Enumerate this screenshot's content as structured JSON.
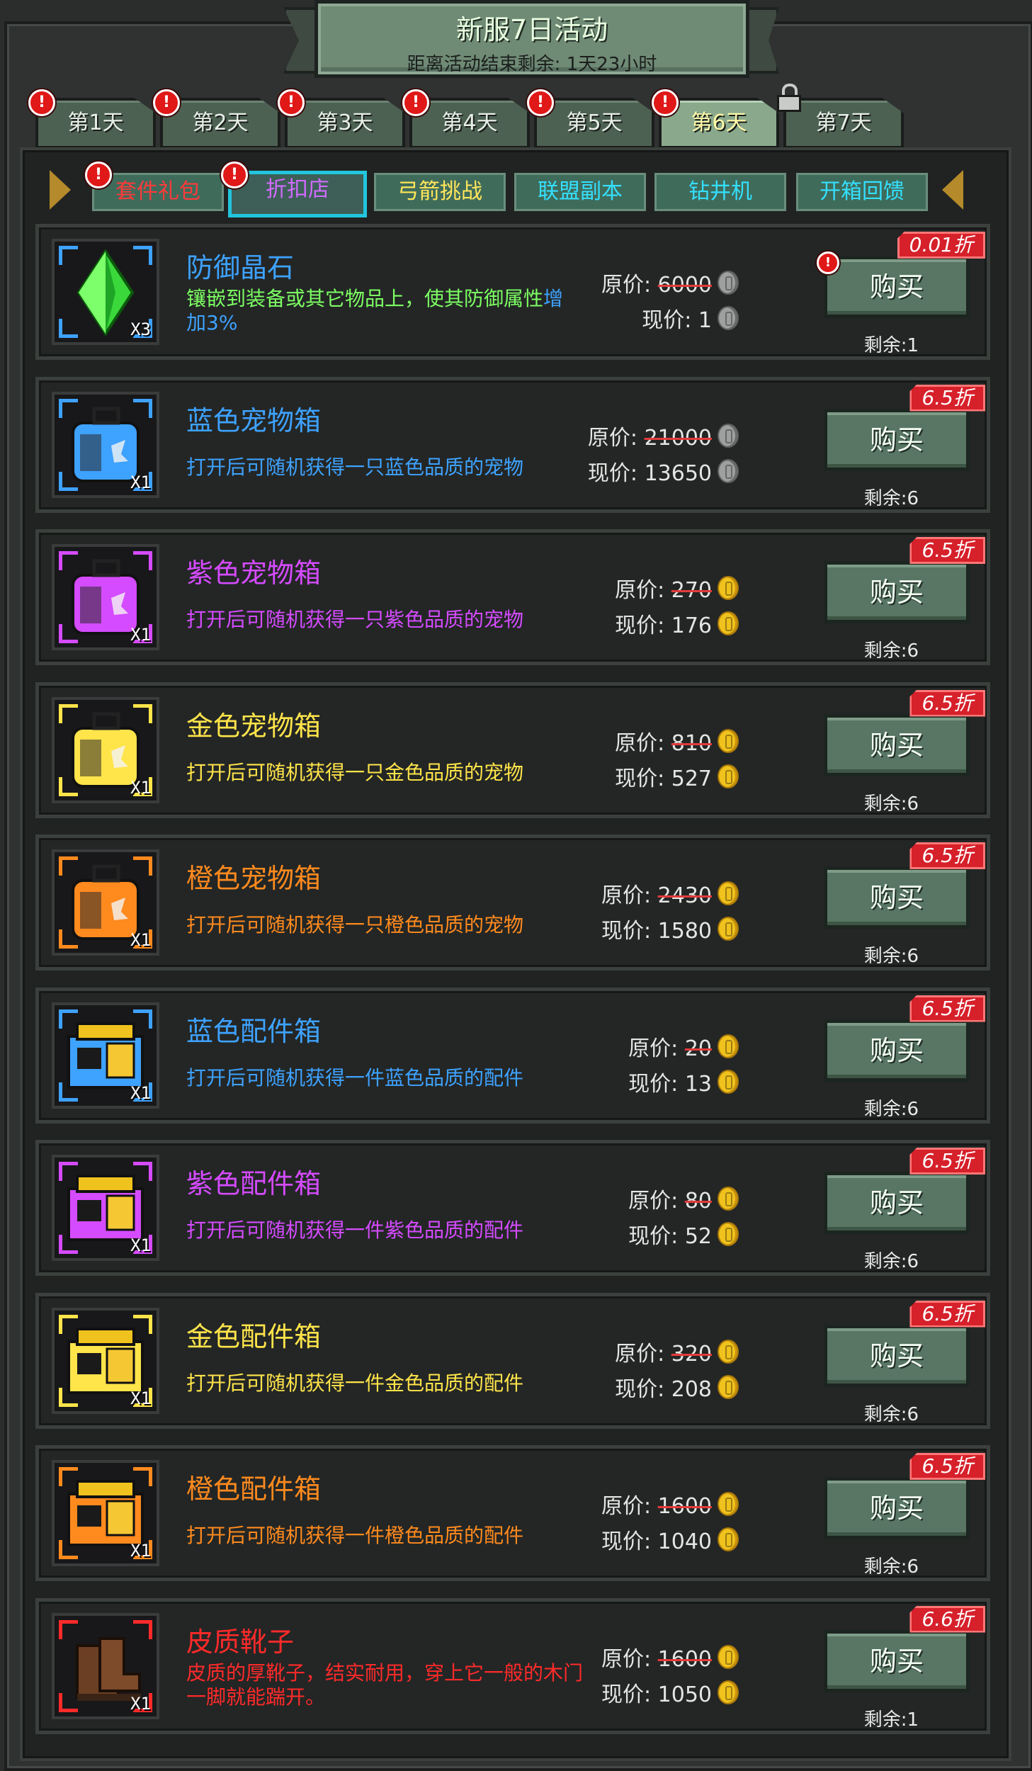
{
  "header": {
    "title": "新服7日活动",
    "subtitle": "距离活动结束剩余: 1天23小时"
  },
  "day_tabs": [
    {
      "label": "第1天",
      "alert": true,
      "active": false,
      "locked": false
    },
    {
      "label": "第2天",
      "alert": true,
      "active": false,
      "locked": false
    },
    {
      "label": "第3天",
      "alert": true,
      "active": false,
      "locked": false
    },
    {
      "label": "第4天",
      "alert": true,
      "active": false,
      "locked": false
    },
    {
      "label": "第5天",
      "alert": true,
      "active": false,
      "locked": false
    },
    {
      "label": "第6天",
      "alert": true,
      "active": true,
      "locked": false
    },
    {
      "label": "第7天",
      "alert": false,
      "active": false,
      "locked": true
    }
  ],
  "sub_tabs": [
    {
      "label": "套件礼包",
      "alert": true,
      "active": false,
      "color": "#ff3a3a"
    },
    {
      "label": "折扣店",
      "alert": true,
      "active": true,
      "color": "#d26bff"
    },
    {
      "label": "弓箭挑战",
      "alert": false,
      "active": false,
      "color": "#ffe65a"
    },
    {
      "label": "联盟副本",
      "alert": false,
      "active": false,
      "color": "#34e0ff"
    },
    {
      "label": "钻井机",
      "alert": false,
      "active": false,
      "color": "#34e0ff"
    },
    {
      "label": "开箱回馈",
      "alert": false,
      "active": false,
      "color": "#34e0ff"
    }
  ],
  "alert_mark": "!",
  "labels": {
    "original_price": "原价: ",
    "current_price": "现价: ",
    "buy": "购买",
    "remaining_prefix": "剩余:"
  },
  "items": [
    {
      "name": "防御晶石",
      "desc": "镶嵌到装备或其它物品上，使其防御属性增加3%",
      "desc_extra": "增加3%",
      "count": "X3",
      "original": "6000",
      "current": "1",
      "currency": "silver",
      "discount": "0.01折",
      "remaining": "1",
      "color": "#3ea2ff",
      "desc_color": "#7dff63",
      "icon": "green-crystal-icon",
      "alert": true
    },
    {
      "name": "蓝色宠物箱",
      "desc": "打开后可随机获得一只蓝色品质的宠物",
      "count": "X1",
      "original": "21000",
      "current": "13650",
      "currency": "silver",
      "discount": "6.5折",
      "remaining": "6",
      "color": "#3ea2ff",
      "desc_color": "#3ea2ff",
      "icon": "blue-pet-crate-icon",
      "alert": false
    },
    {
      "name": "紫色宠物箱",
      "desc": "打开后可随机获得一只紫色品质的宠物",
      "count": "X1",
      "original": "270",
      "current": "176",
      "currency": "gold",
      "discount": "6.5折",
      "remaining": "6",
      "color": "#d54bff",
      "desc_color": "#d54bff",
      "icon": "purple-pet-crate-icon",
      "alert": false
    },
    {
      "name": "金色宠物箱",
      "desc": "打开后可随机获得一只金色品质的宠物",
      "count": "X1",
      "original": "810",
      "current": "527",
      "currency": "gold",
      "discount": "6.5折",
      "remaining": "6",
      "color": "#ffe44a",
      "desc_color": "#ffe44a",
      "icon": "gold-pet-crate-icon",
      "alert": false
    },
    {
      "name": "橙色宠物箱",
      "desc": "打开后可随机获得一只橙色品质的宠物",
      "count": "X1",
      "original": "2430",
      "current": "1580",
      "currency": "gold",
      "discount": "6.5折",
      "remaining": "6",
      "color": "#ff8a1e",
      "desc_color": "#ff8a1e",
      "icon": "orange-pet-crate-icon",
      "alert": false
    },
    {
      "name": "蓝色配件箱",
      "desc": "打开后可随机获得一件蓝色品质的配件",
      "count": "X1",
      "original": "20",
      "current": "13",
      "currency": "gold",
      "discount": "6.5折",
      "remaining": "6",
      "color": "#3ea2ff",
      "desc_color": "#3ea2ff",
      "icon": "blue-parts-crate-icon",
      "alert": false
    },
    {
      "name": "紫色配件箱",
      "desc": "打开后可随机获得一件紫色品质的配件",
      "count": "X1",
      "original": "80",
      "current": "52",
      "currency": "gold",
      "discount": "6.5折",
      "remaining": "6",
      "color": "#d54bff",
      "desc_color": "#d54bff",
      "icon": "purple-parts-crate-icon",
      "alert": false
    },
    {
      "name": "金色配件箱",
      "desc": "打开后可随机获得一件金色品质的配件",
      "count": "X1",
      "original": "320",
      "current": "208",
      "currency": "gold",
      "discount": "6.5折",
      "remaining": "6",
      "color": "#ffe44a",
      "desc_color": "#ffe44a",
      "icon": "gold-parts-crate-icon",
      "alert": false
    },
    {
      "name": "橙色配件箱",
      "desc": "打开后可随机获得一件橙色品质的配件",
      "count": "X1",
      "original": "1600",
      "current": "1040",
      "currency": "gold",
      "discount": "6.5折",
      "remaining": "6",
      "color": "#ff8a1e",
      "desc_color": "#ff8a1e",
      "icon": "orange-parts-crate-icon",
      "alert": false
    },
    {
      "name": "皮质靴子",
      "desc": "皮质的厚靴子，结实耐用，穿上它一般的木门一脚就能踹开。",
      "count": "X1",
      "original": "1600",
      "current": "1050",
      "currency": "gold",
      "discount": "6.6折",
      "remaining": "1",
      "color": "#ff2a2a",
      "desc_color": "#ff2a2a",
      "icon": "leather-boots-icon",
      "alert": false
    }
  ]
}
